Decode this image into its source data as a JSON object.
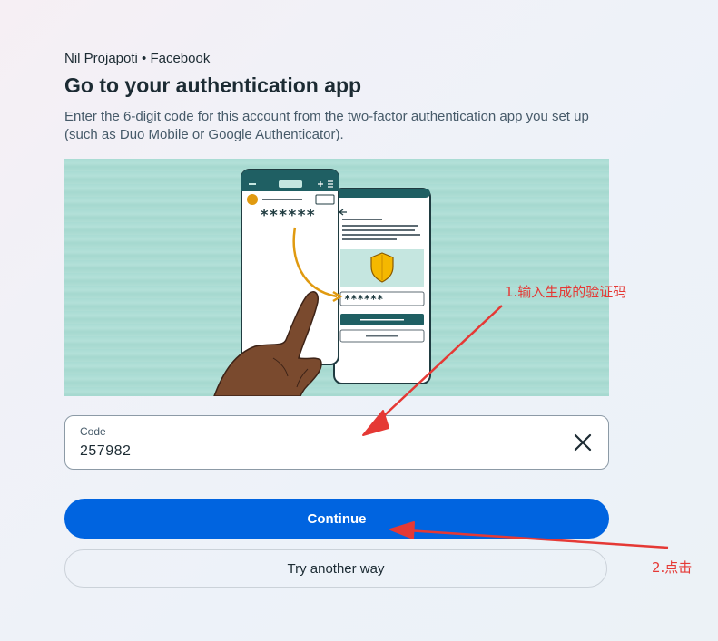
{
  "header": {
    "account_line": "Nil Projapoti • Facebook",
    "title": "Go to your authentication app",
    "description": "Enter the 6-digit code for this account from the two-factor authentication app you set up (such as Duo Mobile or Google Authenticator)."
  },
  "illustration": {
    "masked_code_left": "******",
    "masked_code_right": "******"
  },
  "code_field": {
    "label": "Code",
    "value": "257982",
    "clear_icon": "close-icon"
  },
  "buttons": {
    "continue_label": "Continue",
    "try_another_label": "Try another way"
  },
  "annotations": {
    "step1": "1.输入生成的验证码",
    "step2": "2.点击",
    "color": "#e53935"
  },
  "colors": {
    "primary": "#0064e0",
    "illustration_bg": "#a9dbd3",
    "phone_accent": "#1f5f63",
    "shield": "#f5b800"
  }
}
